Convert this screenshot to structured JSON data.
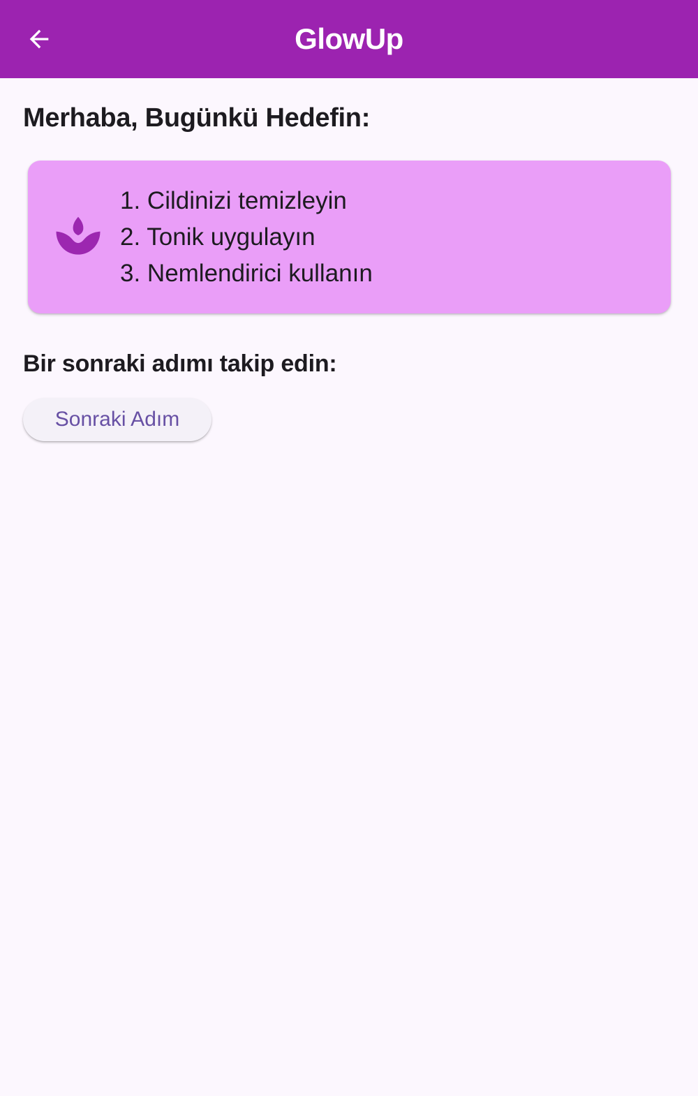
{
  "app_bar": {
    "title": "GlowUp",
    "background_color": "#9C23B0",
    "back_icon": "arrow-back-icon"
  },
  "main": {
    "greeting": "Merhaba, Bugünkü Hedefin:",
    "routine_card": {
      "icon": "spa-icon",
      "icon_color": "#9C27B0",
      "background_color": "#EA9EF8",
      "steps": [
        "1. Cildinizi temizleyin",
        "2. Tonik uygulayın",
        "3. Nemlendirici kullanın"
      ]
    },
    "next_heading": "Bir sonraki adımı takip edin:",
    "next_button_label": "Sonraki Adım"
  }
}
